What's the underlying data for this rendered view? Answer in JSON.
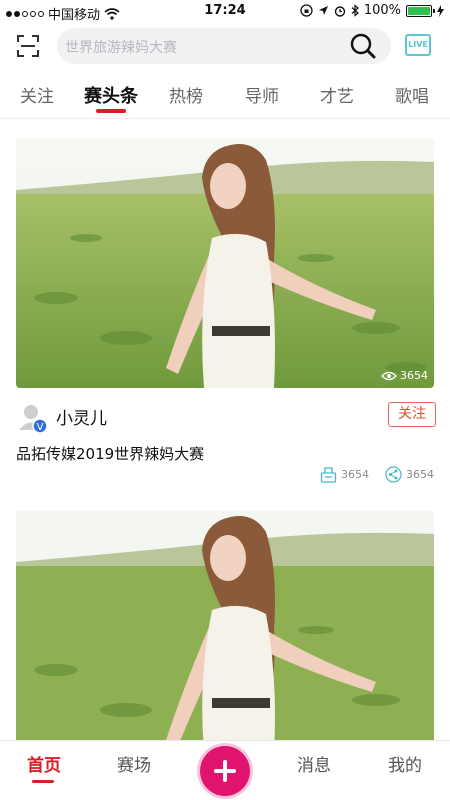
{
  "status_bar": {
    "carrier": "中国移动",
    "time": "17:24",
    "battery_percent": "100%"
  },
  "search": {
    "placeholder": "世界旅游辣妈大赛",
    "live_label": "LIVE"
  },
  "tabs": [
    {
      "label": "关注",
      "active": false
    },
    {
      "label": "赛头条",
      "active": true
    },
    {
      "label": "热榜",
      "active": false
    },
    {
      "label": "导师",
      "active": false
    },
    {
      "label": "才艺",
      "active": false
    },
    {
      "label": "歌唱",
      "active": false
    }
  ],
  "posts": [
    {
      "views": "3654",
      "author": {
        "name": "小灵儿",
        "verified_badge": "V"
      },
      "follow_label": "关注",
      "title": "品拓传媒2019世界辣妈大赛",
      "stats": {
        "votes": "3654",
        "shares": "3654"
      }
    }
  ],
  "bottom_nav": {
    "items": [
      {
        "label": "首页",
        "active": true
      },
      {
        "label": "赛场",
        "active": false
      },
      {
        "label": "消息",
        "active": false
      },
      {
        "label": "我的",
        "active": false
      }
    ]
  },
  "colors": {
    "accent": "#d81f26",
    "fab": "#e0146f",
    "live": "#5bc7d3",
    "stats_icon": "#4bb7c6"
  },
  "icons": {
    "scan": "scan-icon",
    "search": "search-icon",
    "live": "live-icon",
    "eye": "eye-icon",
    "avatar": "avatar-icon",
    "vote": "ballot-icon",
    "share": "share-icon",
    "add": "plus-icon"
  }
}
